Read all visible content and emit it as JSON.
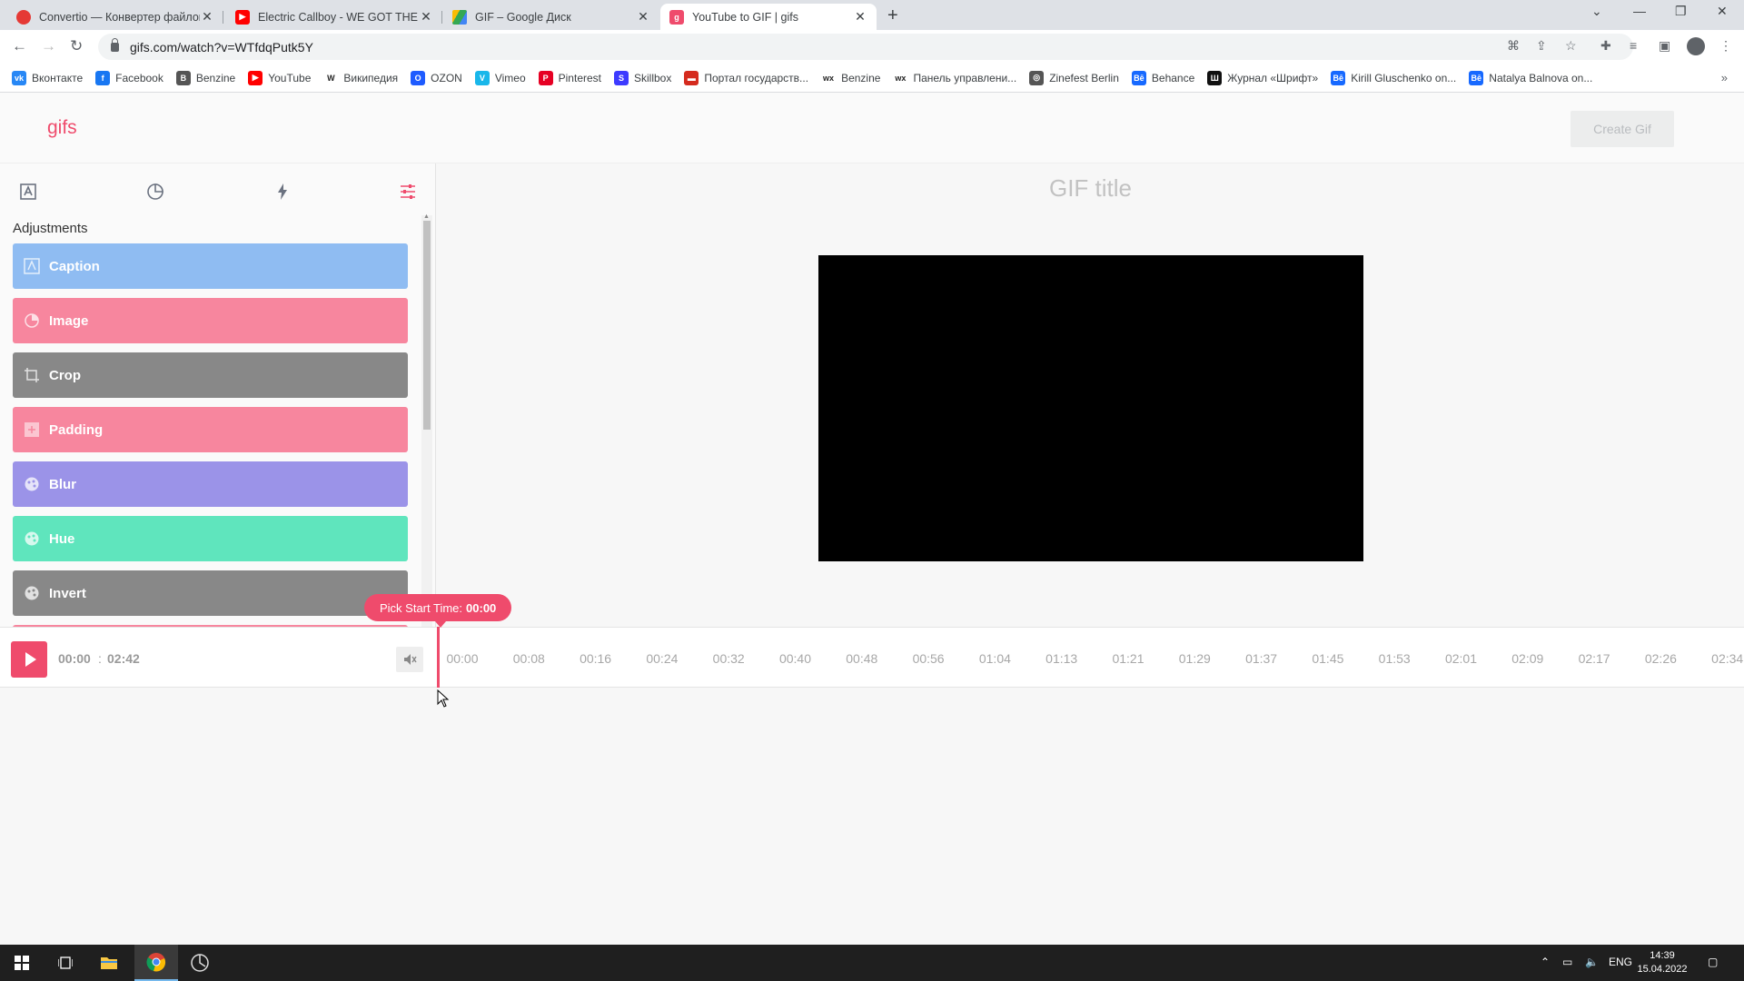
{
  "browser": {
    "tabs": [
      {
        "title": "Convertio — Конвертер файлов",
        "icon": "convertio-icon",
        "color": "#e53935"
      },
      {
        "title": "Electric Callboy - WE GOT THE M",
        "icon": "youtube-icon",
        "color": "#ff0000"
      },
      {
        "title": "GIF – Google Диск",
        "icon": "google-drive-icon",
        "color": "#34a853"
      },
      {
        "title": "YouTube to GIF | gifs",
        "icon": "gifs-icon",
        "color": "#ef4b6c"
      }
    ],
    "url": "gifs.com/watch?v=WTfdqPutk5Y",
    "bookmarks": [
      {
        "label": "Вконтакте",
        "icon": "vk-icon",
        "color": "#2787f5",
        "glyph": "vk"
      },
      {
        "label": "Facebook",
        "icon": "facebook-icon",
        "color": "#1877f2",
        "glyph": "f"
      },
      {
        "label": "Benzine",
        "icon": "benzine-icon",
        "color": "#555555",
        "glyph": "B"
      },
      {
        "label": "YouTube",
        "icon": "youtube-icon",
        "color": "#ff0000",
        "glyph": "▶"
      },
      {
        "label": "Википедия",
        "icon": "wikipedia-icon",
        "color": "#ffffff",
        "glyph": "W"
      },
      {
        "label": "OZON",
        "icon": "ozon-icon",
        "color": "#1e5bff",
        "glyph": "O"
      },
      {
        "label": "Vimeo",
        "icon": "vimeo-icon",
        "color": "#19b7ea",
        "glyph": "V"
      },
      {
        "label": "Pinterest",
        "icon": "pinterest-icon",
        "color": "#e60023",
        "glyph": "P"
      },
      {
        "label": "Skillbox",
        "icon": "skillbox-icon",
        "color": "#3d3bff",
        "glyph": "S"
      },
      {
        "label": "Портал государств...",
        "icon": "gosuslugi-icon",
        "color": "#d52b1e",
        "glyph": "▬"
      },
      {
        "label": "Benzine",
        "icon": "wix-icon",
        "color": "#ffffff",
        "glyph": "wx"
      },
      {
        "label": "Панель управлени...",
        "icon": "wix-icon",
        "color": "#ffffff",
        "glyph": "wx"
      },
      {
        "label": "Zinefest Berlin",
        "icon": "globe-icon",
        "color": "#555555",
        "glyph": "◎"
      },
      {
        "label": "Behance",
        "icon": "behance-icon",
        "color": "#1769ff",
        "glyph": "Bē"
      },
      {
        "label": "Журнал «Шрифт»",
        "icon": "shrift-icon",
        "color": "#111111",
        "glyph": "Ш"
      },
      {
        "label": "Kirill Gluschenko on...",
        "icon": "behance-icon",
        "color": "#1769ff",
        "glyph": "Bē"
      },
      {
        "label": "Natalya Balnova on...",
        "icon": "behance-icon",
        "color": "#1769ff",
        "glyph": "Bē"
      }
    ]
  },
  "app": {
    "logo": "gifs",
    "create_button": "Create Gif",
    "sidebar_heading": "Adjustments",
    "gif_title": "GIF title",
    "adjustments": [
      {
        "label": "Caption",
        "color": "#8fbcf2",
        "icon": "caption-icon"
      },
      {
        "label": "Image",
        "color": "#f7869e",
        "icon": "image-icon"
      },
      {
        "label": "Crop",
        "color": "#888888",
        "icon": "crop-icon"
      },
      {
        "label": "Padding",
        "color": "#f7869e",
        "icon": "padding-icon"
      },
      {
        "label": "Blur",
        "color": "#9b93e8",
        "icon": "blur-icon"
      },
      {
        "label": "Hue",
        "color": "#5fe5bd",
        "icon": "hue-icon"
      },
      {
        "label": "Invert",
        "color": "#888888",
        "icon": "invert-icon"
      },
      {
        "label": "",
        "color": "#f7869e",
        "icon": ""
      }
    ],
    "player": {
      "current_time": "00:00",
      "separator": ":",
      "duration": "02:42",
      "pick_start_label": "Pick Start Time:",
      "pick_start_value": "00:00",
      "ticks": [
        "00:00",
        "00:08",
        "00:16",
        "00:24",
        "00:32",
        "00:40",
        "00:48",
        "00:56",
        "01:04",
        "01:13",
        "01:21",
        "01:29",
        "01:37",
        "01:45",
        "01:53",
        "02:01",
        "02:09",
        "02:17",
        "02:26",
        "02:34"
      ]
    },
    "accent_color": "#ef4b6c"
  },
  "taskbar": {
    "language": "ENG",
    "time": "14:39",
    "date": "15.04.2022"
  }
}
